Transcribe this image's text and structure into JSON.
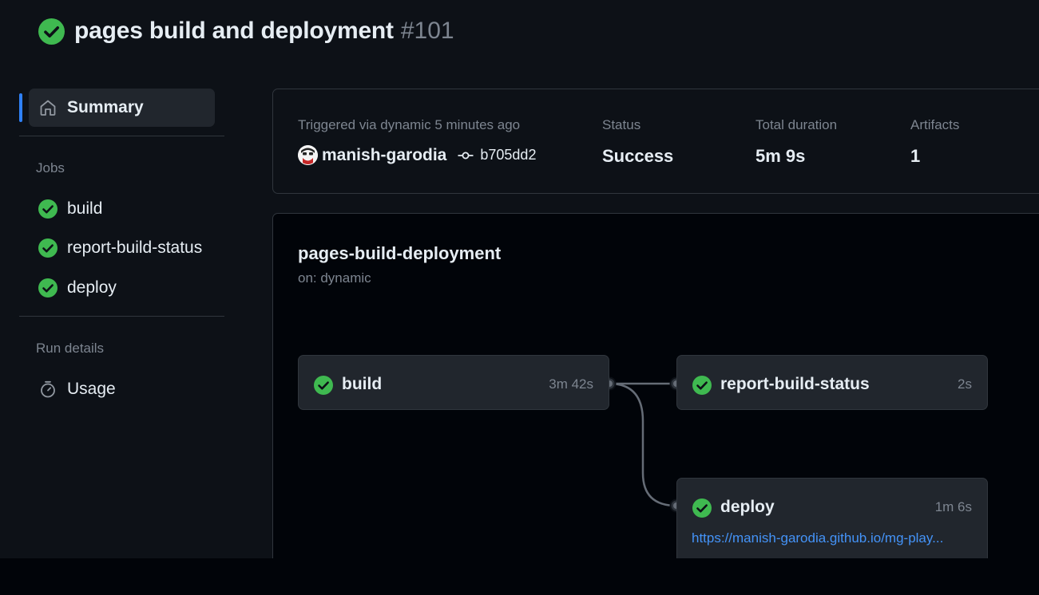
{
  "header": {
    "title": "pages build and deployment",
    "run_number": "#101",
    "status_icon": "check-circle-icon"
  },
  "sidebar": {
    "summary_label": "Summary",
    "jobs_heading": "Jobs",
    "jobs": [
      {
        "label": "build",
        "status": "success"
      },
      {
        "label": "report-build-status",
        "status": "success"
      },
      {
        "label": "deploy",
        "status": "success"
      }
    ],
    "run_details_heading": "Run details",
    "usage_label": "Usage"
  },
  "summary": {
    "trigger_text": "Triggered via dynamic 5 minutes ago",
    "actor": "manish-garodia",
    "commit": "b705dd2",
    "status_label": "Status",
    "status_value": "Success",
    "duration_label": "Total duration",
    "duration_value": "5m 9s",
    "artifacts_label": "Artifacts",
    "artifacts_value": "1"
  },
  "workflow": {
    "name": "pages-build-deployment",
    "trigger": "on: dynamic",
    "jobs": [
      {
        "name": "build",
        "duration": "3m 42s"
      },
      {
        "name": "report-build-status",
        "duration": "2s"
      },
      {
        "name": "deploy",
        "duration": "1m 6s",
        "url": "https://manish-garodia.github.io/mg-play..."
      }
    ]
  },
  "colors": {
    "success": "#3fb950",
    "accent": "#2f81f7",
    "link": "#4493f8",
    "muted": "#7d8590"
  }
}
